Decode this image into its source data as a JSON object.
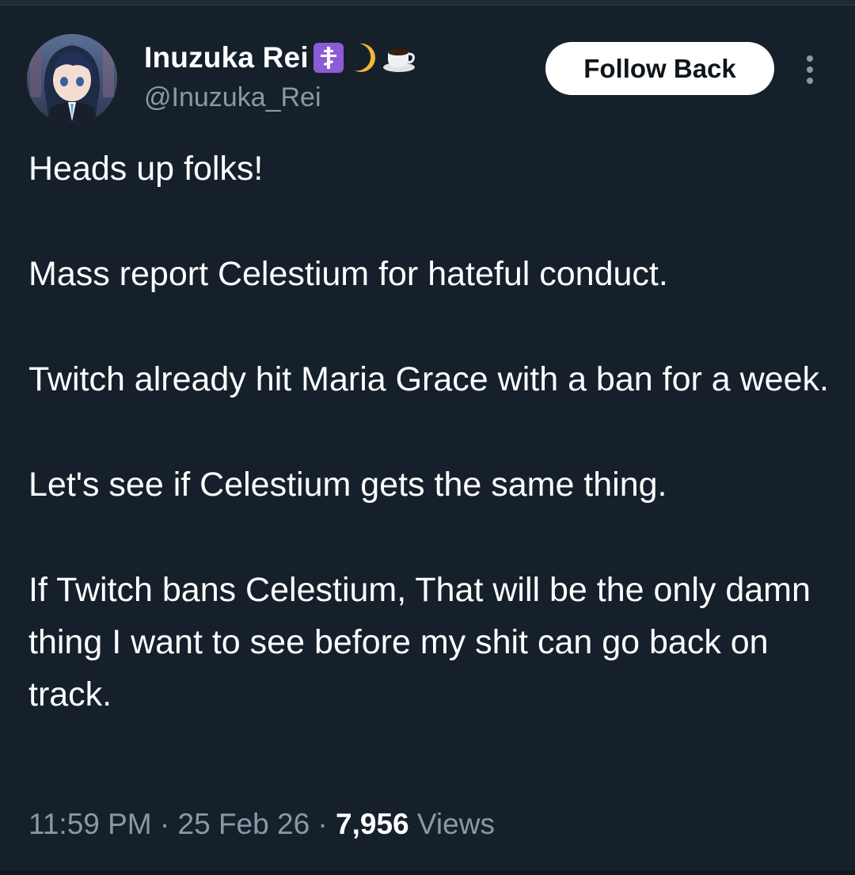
{
  "author": {
    "display_name": "Inuzuka Rei",
    "name_emojis": [
      "orthodox-cross-emoji",
      "crescent-moon-emoji",
      "hot-beverage-emoji"
    ],
    "handle": "@Inuzuka_Rei",
    "avatar": "anime-character-avatar"
  },
  "actions": {
    "follow_label": "Follow Back",
    "more_icon": "vertical-ellipsis-icon"
  },
  "tweet": {
    "paragraphs": [
      "Heads up folks!",
      "Mass report Celestium for hateful conduct.",
      "Twitch already hit Maria Grace with a ban for a week.",
      "Let's see if Celestium gets the same thing.",
      "If Twitch bans Celestium, That will be the only damn thing I want to see before my shit can go back on track."
    ]
  },
  "meta": {
    "time": "11:59 PM",
    "separator": " · ",
    "date": "25 Feb 26",
    "views_count": "7,956",
    "views_label": " Views"
  },
  "colors": {
    "background": "#15202b",
    "text_primary": "#ffffff",
    "text_secondary": "#8b98a5",
    "button_bg": "#ffffff",
    "button_text": "#0f1419"
  }
}
